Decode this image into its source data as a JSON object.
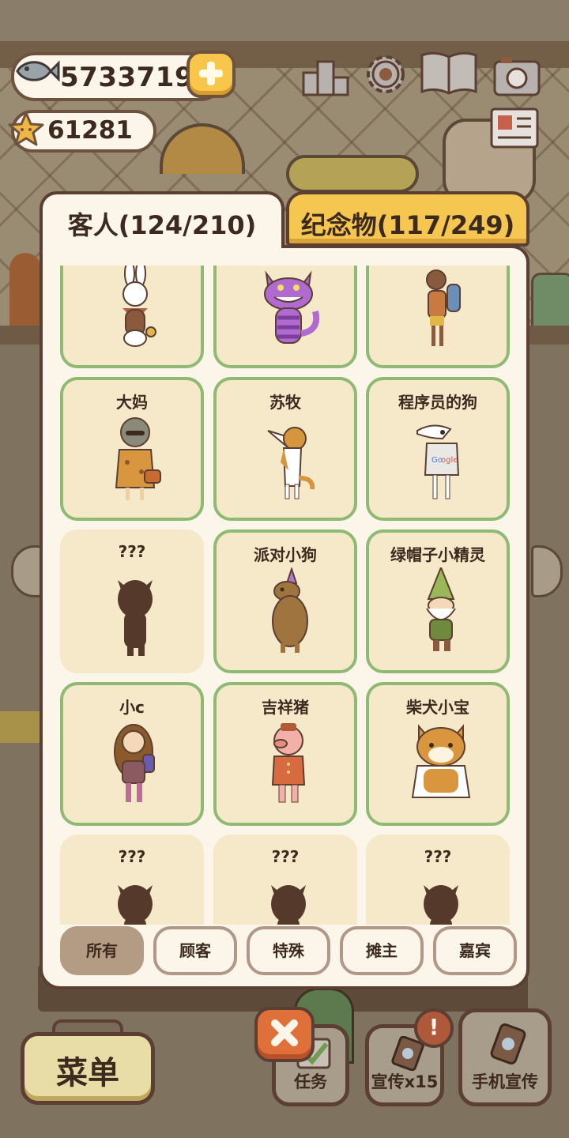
{
  "currency": {
    "fish": "5733719",
    "stars": "61281"
  },
  "top_icons": [
    "ranking-podium-icon",
    "settings-gear-icon",
    "guestbook-icon",
    "camera-icon",
    "newspaper-icon"
  ],
  "tabs": {
    "guests": "客人(124/210)",
    "souvenirs": "纪念物(117/249)"
  },
  "guests": [
    {
      "name": "",
      "figure": "rabbit",
      "unlocked": true
    },
    {
      "name": "",
      "figure": "cheshire-cat",
      "unlocked": true
    },
    {
      "name": "",
      "figure": "traveler",
      "unlocked": true
    },
    {
      "name": "大妈",
      "figure": "auntie",
      "unlocked": true
    },
    {
      "name": "苏牧",
      "figure": "collie",
      "unlocked": true
    },
    {
      "name": "程序员的狗",
      "figure": "programmer-dog",
      "unlocked": true
    },
    {
      "name": "???",
      "figure": "silhouette",
      "unlocked": false
    },
    {
      "name": "派对小狗",
      "figure": "party-dog",
      "unlocked": true
    },
    {
      "name": "绿帽子小精灵",
      "figure": "gnome",
      "unlocked": true
    },
    {
      "name": "小c",
      "figure": "girl",
      "unlocked": true
    },
    {
      "name": "吉祥猪",
      "figure": "lucky-pig",
      "unlocked": true
    },
    {
      "name": "柴犬小宝",
      "figure": "shiba",
      "unlocked": true
    },
    {
      "name": "???",
      "figure": "silhouette",
      "unlocked": false
    },
    {
      "name": "???",
      "figure": "silhouette",
      "unlocked": false
    },
    {
      "name": "???",
      "figure": "silhouette",
      "unlocked": false
    }
  ],
  "filters": [
    {
      "label": "所有",
      "active": true
    },
    {
      "label": "顾客",
      "active": false
    },
    {
      "label": "特殊",
      "active": false
    },
    {
      "label": "摊主",
      "active": false
    },
    {
      "label": "嘉宾",
      "active": false
    }
  ],
  "bottom": {
    "menu": "菜单",
    "tasks": "任务",
    "promo": "宣传x15",
    "phone_promo": "手机宣传",
    "badge": "!"
  },
  "colors": {
    "panel": "#fbf5ea",
    "card": "#f5e9c9",
    "card_border": "#8fba74",
    "active_tab": "#f5c751",
    "outline": "#5a3f32",
    "silhouette": "#553a2c"
  }
}
